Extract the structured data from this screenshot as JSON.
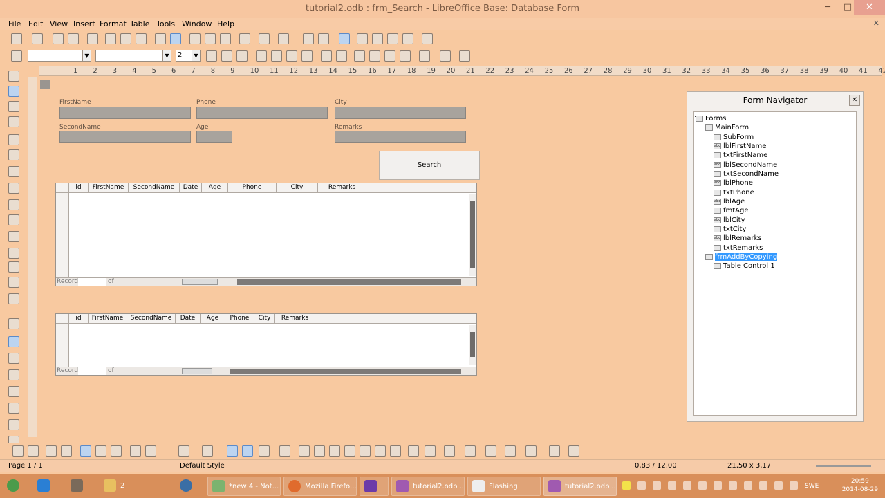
{
  "window": {
    "title": "tutorial2.odb : frm_Search - LibreOffice Base: Database Form",
    "minimize": "─",
    "maximize": "□",
    "close": "✕"
  },
  "menu": {
    "items": [
      "File",
      "Edit",
      "View",
      "Insert",
      "Format",
      "Table",
      "Tools",
      "Window",
      "Help"
    ],
    "close": "✕"
  },
  "format_bar": {
    "size_value": "2"
  },
  "ruler": {
    "numbers": [
      "1",
      "2",
      "3",
      "4",
      "5",
      "6",
      "7",
      "8",
      "9",
      "10",
      "11",
      "12",
      "13",
      "14",
      "15",
      "16",
      "17",
      "18",
      "19",
      "20",
      "21",
      "22",
      "23",
      "24",
      "25",
      "26",
      "27",
      "28",
      "29",
      "30",
      "31",
      "32",
      "33",
      "34",
      "35",
      "36",
      "37",
      "38",
      "39",
      "40",
      "41",
      "42"
    ]
  },
  "form": {
    "labels": {
      "firstname": "FirstName",
      "phone": "Phone",
      "city": "City",
      "secondname": "SecondName",
      "age": "Age",
      "remarks": "Remarks"
    },
    "search_button": "Search"
  },
  "grid1": {
    "columns": [
      "id",
      "FirstName",
      "SecondName",
      "Date",
      "Age",
      "Phone",
      "City",
      "Remarks"
    ],
    "record_label": "Record",
    "of_label": "of"
  },
  "grid2": {
    "columns": [
      "id",
      "FirstName",
      "SecondName",
      "Date",
      "Age",
      "Phone",
      "City",
      "Remarks"
    ],
    "record_label": "Record",
    "of_label": "of"
  },
  "navigator": {
    "title": "Form Navigator",
    "close": "✕",
    "nodes": {
      "forms": "Forms",
      "mainform": "MainForm",
      "subform": "SubForm",
      "lblFirstName": "lblFirstName",
      "txtFirstName": "txtFirstName",
      "lblSecondName": "lblSecondName",
      "txtSecondName": "txtSecondName",
      "lblPhone": "lblPhone",
      "txtPhone": "txtPhone",
      "lblAge": "lblAge",
      "fmtAge": "fmtAge",
      "lblCity": "lblCity",
      "txtCity": "txtCity",
      "lblRemarks": "lblRemarks",
      "txtRemarks": "txtRemarks",
      "frmAddByCopying": "frmAddByCopying",
      "tableControl": "Table Control  1"
    }
  },
  "status": {
    "page": "Page 1 / 1",
    "style": "Default Style",
    "position": "0,83 / 12,00",
    "size": "21,50 x 3,17"
  },
  "taskbar": {
    "group_count": "2",
    "notepad": "*new  4 - Not...",
    "firefox": "Mozilla Firefo...",
    "base1": "tutorial2.odb ...",
    "flashing": "Flashing",
    "base2": "tutorial2.odb ...",
    "lang": "SWE",
    "time": "20:59",
    "date": "2014-08-29"
  },
  "colors": {
    "accent": "#3399ff",
    "background": "#f8c9a0",
    "taskbar": "#d98f5a"
  }
}
